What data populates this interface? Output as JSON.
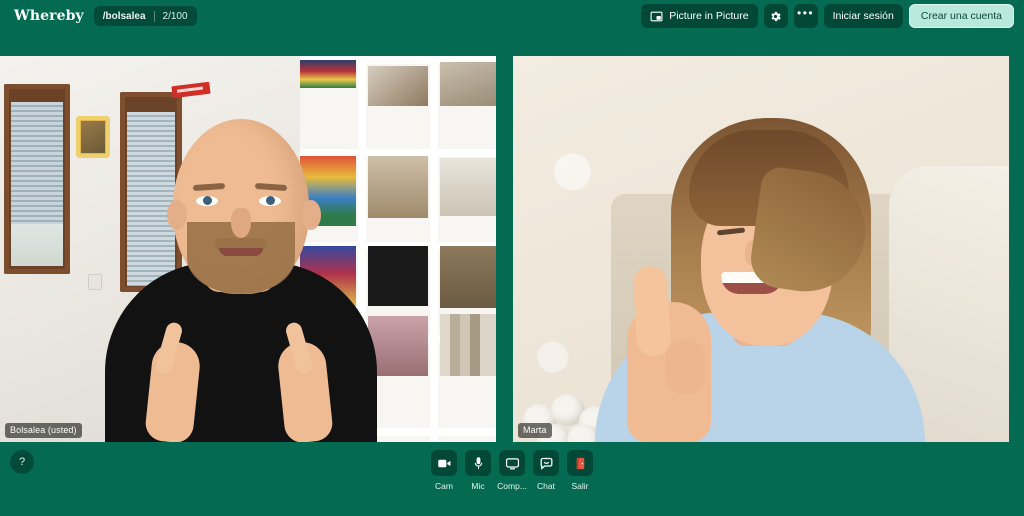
{
  "app": {
    "brand": "Whereby",
    "background_color": "#046b52",
    "accent_color": "#b9e8dc"
  },
  "header": {
    "room": {
      "path": "/bolsalea",
      "participants": "2/100"
    },
    "pip_button": {
      "label": "Picture in Picture",
      "icon": "picture-in-picture-icon"
    },
    "settings_button": {
      "icon": "gear-icon"
    },
    "more_button": {
      "icon": "ellipsis-icon",
      "label": "•••"
    },
    "sign_in_button": {
      "label": "Iniciar sesión"
    },
    "create_account_button": {
      "label": "Crear una cuenta"
    }
  },
  "stage": {
    "tiles": [
      {
        "name_label": "Bolsalea (usted)",
        "is_self": true,
        "scene": "man-making-finger-hearts-in-fabric-workshop"
      },
      {
        "name_label": "Marta",
        "is_self": false,
        "scene": "woman-giving-thumbs-up-in-bedroom"
      }
    ]
  },
  "bottom_bar": {
    "help_button": {
      "label": "?",
      "icon": "question-mark-icon"
    },
    "tools": [
      {
        "label": "Cam",
        "icon": "video-camera-icon",
        "state": "on"
      },
      {
        "label": "Mic",
        "icon": "microphone-icon",
        "state": "on"
      },
      {
        "label": "Comp...",
        "icon": "screen-share-icon",
        "state": "off"
      },
      {
        "label": "Chat",
        "icon": "chat-bubble-icon",
        "state": "off"
      },
      {
        "label": "Salir",
        "icon": "exit-door-icon",
        "state": "danger",
        "color": "#e8563f"
      }
    ]
  }
}
